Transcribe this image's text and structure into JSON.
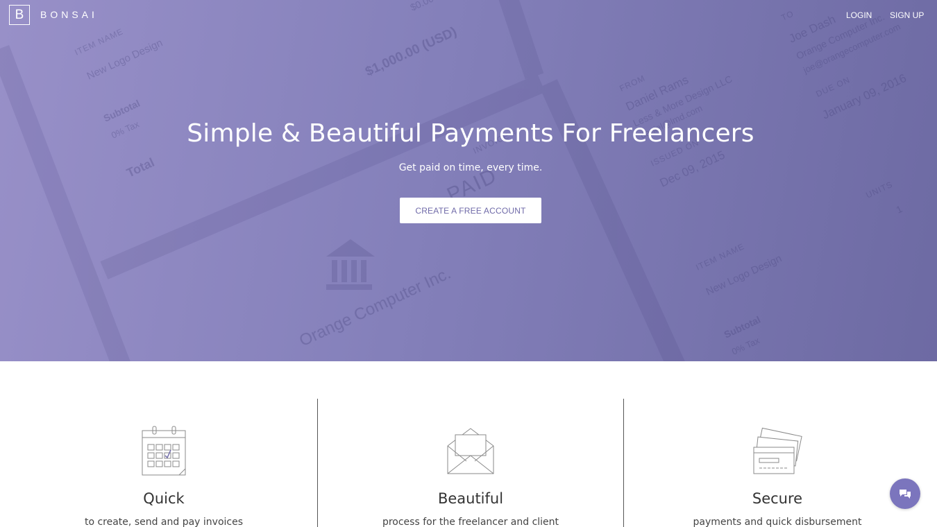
{
  "brand": {
    "logo_letter": "B",
    "name": "BONSAI"
  },
  "nav": {
    "login": "LOGIN",
    "signup": "SIGN UP"
  },
  "hero": {
    "headline": "Simple & Beautiful Payments For Freelancers",
    "subline": "Get paid on time, every time.",
    "cta_label": "CREATE A FREE ACCOUNT"
  },
  "background_invoice": {
    "item_name_label": "ITEM NAME",
    "item": "New Logo Design",
    "subtotal_label": "Subtotal",
    "tax_label": "0% Tax",
    "total_label": "Total",
    "amount": "$1,000.00 (USD)",
    "amount_small": "$0.00",
    "to_label": "TO",
    "to_name": "Joe Dash",
    "to_company": "Orange Computer Inc.",
    "to_email": "joe@orangecomputer.com",
    "from_label": "FROM",
    "from_name": "Daniel Rams",
    "from_company": "Less & More Design LLC",
    "from_email": "daniel@lmd.com",
    "due_label": "DUE ON",
    "due_date": "January 09, 2016",
    "issued_label": "ISSUED ON",
    "issued_date": "Dec 09, 2015",
    "invoice_label": "INVOICE #",
    "paid_stamp": "PAID",
    "units_label": "UNITS",
    "units_value": "1",
    "client_company": "Orange Computer Inc."
  },
  "features": [
    {
      "icon": "calendar-icon",
      "title": "Quick",
      "desc": "to create, send and pay invoices"
    },
    {
      "icon": "envelope-icon",
      "title": "Beautiful",
      "desc": "process for the freelancer and client"
    },
    {
      "icon": "credit-cards-icon",
      "title": "Secure",
      "desc": "payments and quick disbursement"
    }
  ],
  "chat": {
    "icon": "chat-icon"
  },
  "colors": {
    "hero_start": "#9890c8",
    "hero_end": "#6d6aa3",
    "accent": "#7b75bd",
    "cta_text": "#6f6aa8"
  }
}
